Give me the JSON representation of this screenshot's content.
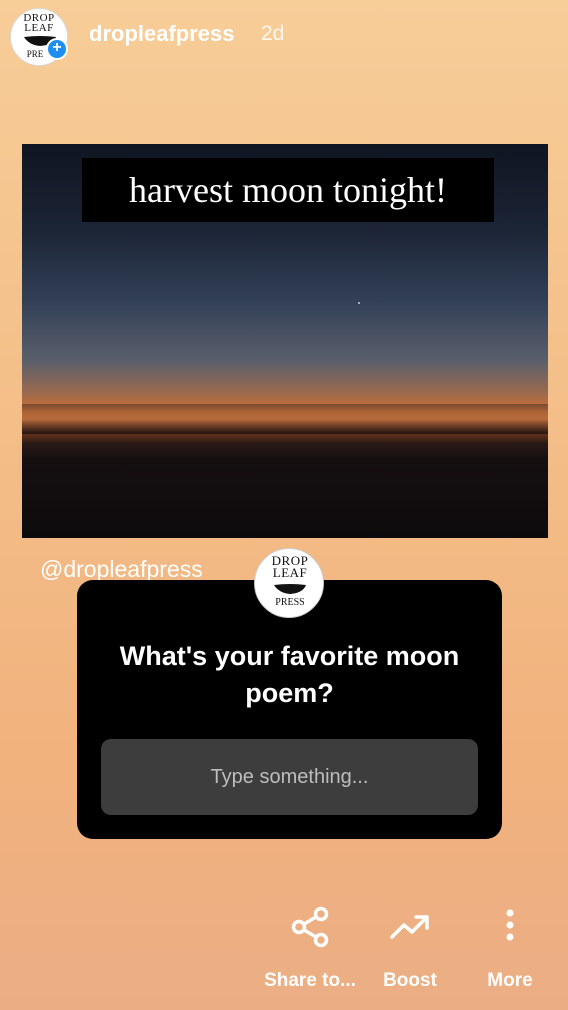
{
  "header": {
    "username": "dropleafpress",
    "timestamp": "2d",
    "avatar_logo_top": "DROP\nLEAF",
    "avatar_logo_bottom": "PRE"
  },
  "photo": {
    "caption": "harvest moon tonight!"
  },
  "mention": "@dropleafpress",
  "question_card": {
    "logo_top": "DROP\nLEAF",
    "logo_bottom": "PRESS",
    "question": "What's your favorite moon poem?",
    "answer_placeholder": "Type something..."
  },
  "actions": [
    {
      "label": "Share to...",
      "icon": "share-icon"
    },
    {
      "label": "Boost",
      "icon": "trending-up-icon"
    },
    {
      "label": "More",
      "icon": "more-vertical-icon"
    }
  ],
  "colors": {
    "background_top": "#f7cd98",
    "background_bottom": "#ebae84",
    "badge_blue": "#1e8ef0",
    "card_black": "#000000",
    "input_gray": "#3d3d3d"
  }
}
